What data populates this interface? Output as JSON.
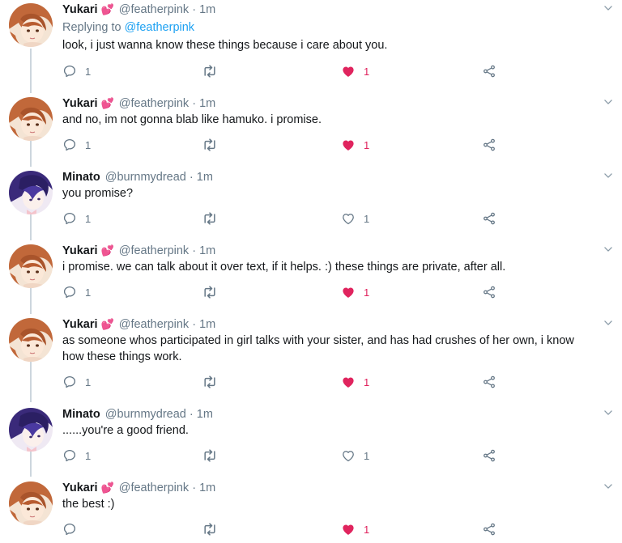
{
  "timeline": {
    "accent": "#1da1f2",
    "like_color": "#e0245e",
    "tweets": [
      {
        "name": "Yukari",
        "badge_icon": "two-hearts-icon",
        "badge": "💕",
        "handle": "@featherpink",
        "time": "· 1m",
        "replying_label": "Replying to",
        "replying_handle": "@featherpink",
        "text": "look, i just wanna know these things because i care about you.",
        "reply_count": "1",
        "retweet_count": "",
        "like_count": "1",
        "liked": true
      },
      {
        "name": "Yukari",
        "badge_icon": "two-hearts-icon",
        "badge": "💕",
        "handle": "@featherpink",
        "time": "· 1m",
        "text": "and no, im not gonna blab like hamuko. i promise.",
        "reply_count": "1",
        "like_count": "1",
        "liked": true
      },
      {
        "name": "Minato",
        "handle": "@burnmydread",
        "time": "· 1m",
        "text": "you promise?",
        "reply_count": "1",
        "like_count": "1",
        "liked": false
      },
      {
        "name": "Yukari",
        "badge_icon": "two-hearts-icon",
        "badge": "💕",
        "handle": "@featherpink",
        "time": "· 1m",
        "text": "i promise. we can talk about it over text, if it helps. :) these things are private, after all.",
        "reply_count": "1",
        "like_count": "1",
        "liked": true
      },
      {
        "name": "Yukari",
        "badge_icon": "two-hearts-icon",
        "badge": "💕",
        "handle": "@featherpink",
        "time": "· 1m",
        "text_line1": "as someone whos participated in girl talks with your sister, and has had crushes of her own, i know",
        "text_line2": "how these things work.",
        "reply_count": "1",
        "like_count": "1",
        "liked": true
      },
      {
        "name": "Minato",
        "handle": "@burnmydread",
        "time": "· 1m",
        "text": "......you're a good friend.",
        "reply_count": "1",
        "like_count": "1",
        "liked": false
      },
      {
        "name": "Yukari",
        "badge_icon": "two-hearts-icon",
        "badge": "💕",
        "handle": "@featherpink",
        "time": "· 1m",
        "text": "the best :)",
        "reply_count": "",
        "like_count": "1",
        "liked": true
      }
    ]
  }
}
